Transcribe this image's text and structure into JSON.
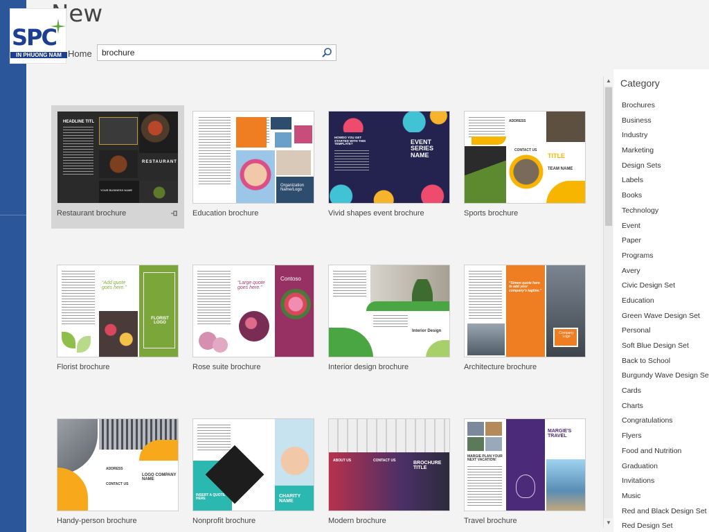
{
  "page": {
    "title": "New",
    "home_label": "Home"
  },
  "logo": {
    "text": "SPC",
    "subtitle": "IN PHUONG NAM"
  },
  "search": {
    "value": "brochure",
    "icon": "search-icon"
  },
  "colors": {
    "accent": "#2b579a",
    "logo": "#1c3f94"
  },
  "templates": [
    {
      "label": "Restaurant brochure",
      "selected": true,
      "thumb_text": [
        "HEADLINE TITL",
        "RESTAURANT",
        "YOUR BUSINESS NAME"
      ]
    },
    {
      "label": "Education brochure",
      "thumb_text": [
        "Organization Name/Logo"
      ]
    },
    {
      "label": "Vivid shapes event brochure",
      "thumb_text": [
        "EVENT SERIES NAME",
        "HOWDO YOU GET STARTED WITH THIS TEMPLATE?"
      ]
    },
    {
      "label": "Sports brochure",
      "thumb_text": [
        "TITLE",
        "TEAM NAME",
        "CONTACT US",
        "ADDRESS"
      ]
    },
    {
      "label": "Florist brochure",
      "thumb_text": [
        "“Add quote goes here.”",
        "FLORIST LOGO"
      ]
    },
    {
      "label": "Rose suite brochure",
      "thumb_text": [
        "“Large quote goes here.”",
        "Contoso"
      ]
    },
    {
      "label": "Interior design brochure",
      "thumb_text": [
        "Interior Design"
      ]
    },
    {
      "label": "Architecture brochure",
      "thumb_text": [
        "“Simon quote here to add your company's tagline.”",
        "Company Logo"
      ]
    },
    {
      "label": "Handy-person brochure",
      "thumb_text": [
        "ADDRESS",
        "CONTACT US",
        "LOGO COMPANY NAME"
      ]
    },
    {
      "label": "Nonprofit brochure",
      "thumb_text": [
        "CHARITY NAME",
        "INSERT A QUOTE HERE"
      ]
    },
    {
      "label": "Modern brochure",
      "thumb_text": [
        "BROCHURE TITLE",
        "ABOUT US",
        "CONTACT US"
      ]
    },
    {
      "label": "Travel brochure",
      "thumb_text": [
        "MARGIE'S TRAVEL",
        "MARGIE PLAN YOUR NEXT VACATION!"
      ]
    }
  ],
  "pin_icon": "pin-icon",
  "category": {
    "title": "Category",
    "items": [
      "Brochures",
      "Business",
      "Industry",
      "Marketing",
      "Design Sets",
      "Labels",
      "Books",
      "Technology",
      "Event",
      "Paper",
      "Programs",
      "Avery",
      "Civic Design Set",
      "Education",
      "Green Wave Design Set",
      "Personal",
      "Soft Blue Design Set",
      "Back to School",
      "Burgundy Wave Design Set",
      "Cards",
      "Charts",
      "Congratulations",
      "Flyers",
      "Food and Nutrition",
      "Graduation",
      "Invitations",
      "Music",
      "Red and Black Design Set",
      "Red Design Set"
    ]
  }
}
